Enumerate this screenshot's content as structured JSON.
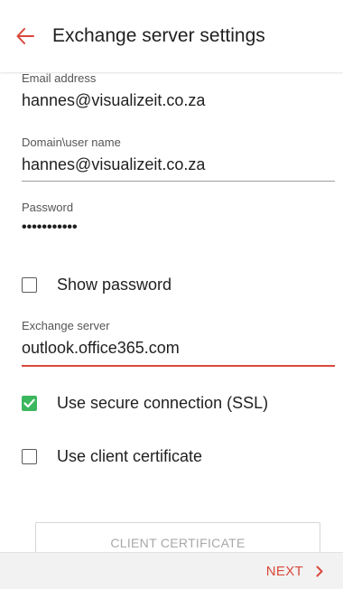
{
  "header": {
    "title": "Exchange server settings"
  },
  "fields": {
    "email": {
      "label": "Email address",
      "value": "hannes@visualizeit.co.za"
    },
    "domain_user": {
      "label": "Domain\\user name",
      "value": "hannes@visualizeit.co.za"
    },
    "password": {
      "label": "Password",
      "value": "•••••••••••"
    },
    "exchange_server": {
      "label": "Exchange server",
      "value": "outlook.office365.com"
    }
  },
  "options": {
    "show_password": {
      "label": "Show password",
      "checked": false
    },
    "use_ssl": {
      "label": "Use secure connection (SSL)",
      "checked": true
    },
    "use_client_cert": {
      "label": "Use client certificate",
      "checked": false
    }
  },
  "buttons": {
    "client_certificate": "CLIENT CERTIFICATE",
    "next": "NEXT"
  },
  "colors": {
    "accent": "#d9483b",
    "checkbox_checked": "#3bb75e"
  },
  "icons": {
    "back": "arrow-left-icon",
    "next": "chevron-right-icon",
    "check": "checkmark-icon"
  }
}
